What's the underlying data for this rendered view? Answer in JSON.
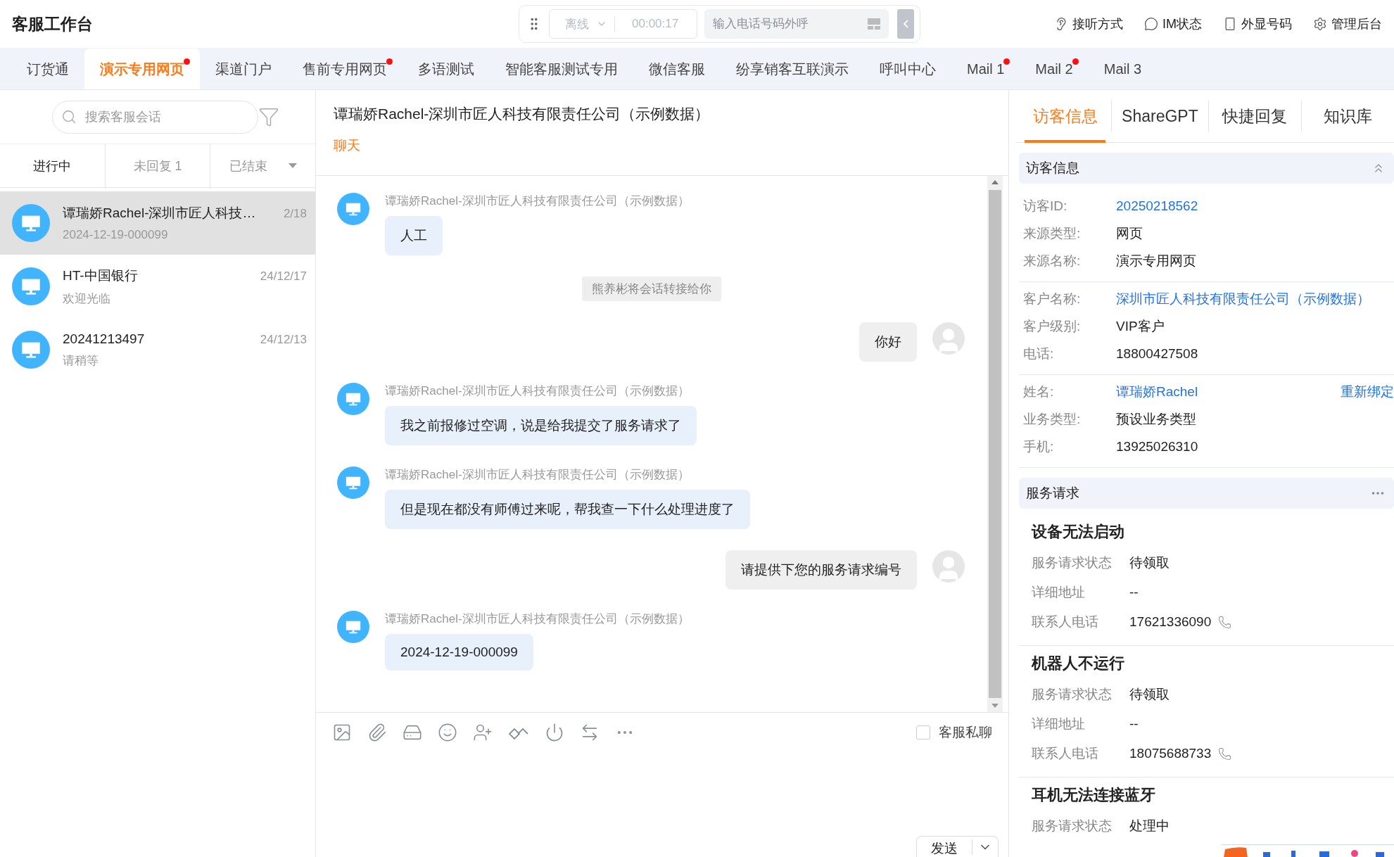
{
  "app_title": "客服工作台",
  "call_bar": {
    "status": "离线",
    "timer": "00:00:17",
    "phone_placeholder": "输入电话号码外呼"
  },
  "header_actions": [
    {
      "kind": "ear",
      "label": "接听方式"
    },
    {
      "kind": "chat",
      "label": "IM状态"
    },
    {
      "kind": "phone",
      "label": "外显号码"
    },
    {
      "kind": "gear",
      "label": "管理后台"
    }
  ],
  "tabs": [
    {
      "label": "订货通",
      "selected": false,
      "unread": false
    },
    {
      "label": "演示专用网页",
      "selected": true,
      "unread": true
    },
    {
      "label": "渠道门户",
      "selected": false,
      "unread": false
    },
    {
      "label": "售前专用网页",
      "selected": false,
      "unread": true
    },
    {
      "label": "多语测试",
      "selected": false,
      "unread": false
    },
    {
      "label": "智能客服测试专用",
      "selected": false,
      "unread": false
    },
    {
      "label": "微信客服",
      "selected": false,
      "unread": false
    },
    {
      "label": "纷享销客互联演示",
      "selected": false,
      "unread": false
    },
    {
      "label": "呼叫中心",
      "selected": false,
      "unread": false
    },
    {
      "label": "Mail 1",
      "selected": false,
      "unread": true
    },
    {
      "label": "Mail 2",
      "selected": false,
      "unread": true
    },
    {
      "label": "Mail 3",
      "selected": false,
      "unread": false
    }
  ],
  "sidebar": {
    "search_placeholder": "搜索客服会话",
    "filters": [
      {
        "label": "进行中",
        "selected": true,
        "dropdown": false
      },
      {
        "label": "未回复 1",
        "selected": false,
        "dropdown": false
      },
      {
        "label": "已结束",
        "selected": false,
        "dropdown": true
      }
    ],
    "conversations": [
      {
        "name": "谭瑞娇Rachel-深圳市匠人科技…",
        "preview": "2024-12-19-000099",
        "date": "2/18",
        "selected": true
      },
      {
        "name": "HT-中国银行",
        "preview": "欢迎光临",
        "date": "24/12/17",
        "selected": false
      },
      {
        "name": "20241213497",
        "preview": "请稍等",
        "date": "24/12/13",
        "selected": false
      }
    ]
  },
  "chat": {
    "title": "谭瑞娇Rachel-深圳市匠人科技有限责任公司（示例数据）",
    "subtab": "聊天",
    "messages": [
      {
        "kind": "incoming",
        "sender": "谭瑞娇Rachel-深圳市匠人科技有限责任公司（示例数据）",
        "text": "人工"
      },
      {
        "kind": "system",
        "text": "熊养彬将会话转接给你"
      },
      {
        "kind": "outgoing",
        "text": "你好"
      },
      {
        "kind": "incoming",
        "sender": "谭瑞娇Rachel-深圳市匠人科技有限责任公司（示例数据）",
        "text": "我之前报修过空调，说是给我提交了服务请求了"
      },
      {
        "kind": "incoming",
        "sender": "谭瑞娇Rachel-深圳市匠人科技有限责任公司（示例数据）",
        "text": "但是现在都没有师傅过来呢，帮我查一下什么处理进度了"
      },
      {
        "kind": "outgoing",
        "text": "请提供下您的服务请求编号"
      },
      {
        "kind": "incoming",
        "sender": "谭瑞娇Rachel-深圳市匠人科技有限责任公司（示例数据）",
        "text": "2024-12-19-000099"
      }
    ],
    "private_chat": {
      "label": "客服私聊",
      "checked": false
    },
    "send_button": "发送"
  },
  "right_panel": {
    "tabs": [
      {
        "label": "访客信息",
        "selected": true
      },
      {
        "label": "ShareGPT",
        "selected": false
      },
      {
        "label": "快捷回复",
        "selected": false
      },
      {
        "label": "知识库",
        "selected": false
      }
    ],
    "visitor_info": {
      "title": "访客信息",
      "expanded": true,
      "groups": [
        [
          {
            "label": "访客ID:",
            "value": "20250218562",
            "link": true
          },
          {
            "label": "来源类型:",
            "value": "网页",
            "link": false
          },
          {
            "label": "来源名称:",
            "value": "演示专用网页",
            "link": false
          }
        ],
        [
          {
            "label": "客户名称:",
            "value": "深圳市匠人科技有限责任公司（示例数据）",
            "link": true
          },
          {
            "label": "客户级别:",
            "value": "VIP客户",
            "link": false
          },
          {
            "label": "电话:",
            "value": "18800427508",
            "link": false
          }
        ],
        [
          {
            "label": "姓名:",
            "value": "谭瑞娇Rachel",
            "link": true,
            "action": "重新绑定"
          },
          {
            "label": "业务类型:",
            "value": "预设业务类型",
            "link": false
          },
          {
            "label": "手机:",
            "value": "13925026310",
            "link": false
          }
        ]
      ]
    },
    "service_requests": {
      "title": "服务请求",
      "items": [
        {
          "title": "设备无法启动",
          "fields": [
            {
              "label": "服务请求状态",
              "value": "待领取",
              "kind": "text"
            },
            {
              "label": "详细地址",
              "value": "--",
              "kind": "text"
            },
            {
              "label": "联系人电话",
              "value": "17621336090",
              "kind": "phone"
            }
          ]
        },
        {
          "title": "机器人不运行",
          "fields": [
            {
              "label": "服务请求状态",
              "value": "待领取",
              "kind": "text"
            },
            {
              "label": "详细地址",
              "value": "--",
              "kind": "text"
            },
            {
              "label": "联系人电话",
              "value": "18075688733",
              "kind": "phone"
            }
          ]
        },
        {
          "title": "耳机无法连接蓝牙",
          "fields": [
            {
              "label": "服务请求状态",
              "value": "处理中",
              "kind": "text"
            }
          ]
        }
      ]
    }
  }
}
